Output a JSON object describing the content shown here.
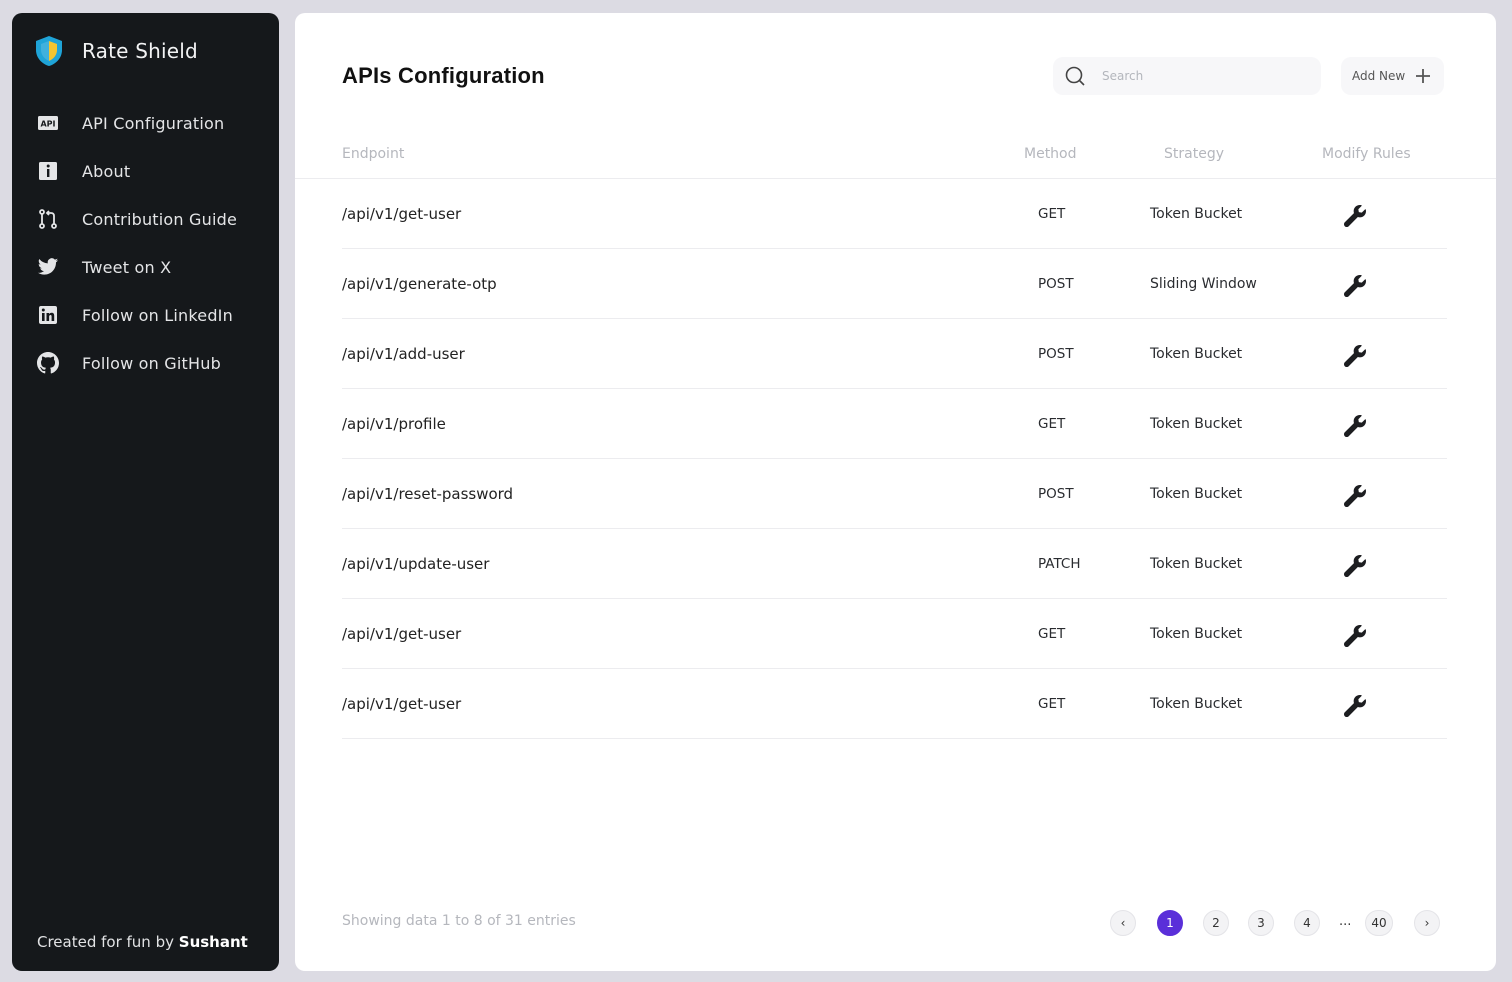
{
  "brand": {
    "name": "Rate Shield",
    "logo_icon": "shield-icon"
  },
  "nav": [
    {
      "icon": "api-icon",
      "label": "API Configuration"
    },
    {
      "icon": "info-icon",
      "label": "About"
    },
    {
      "icon": "git-pull-request-icon",
      "label": "Contribution Guide"
    },
    {
      "icon": "twitter-icon",
      "label": "Tweet on X"
    },
    {
      "icon": "linkedin-icon",
      "label": "Follow on LinkedIn"
    },
    {
      "icon": "github-icon",
      "label": "Follow on GitHub"
    }
  ],
  "footer": {
    "prefix": "Created for fun by ",
    "author": "Sushant"
  },
  "main": {
    "title": "APIs Configuration",
    "search_placeholder": "Search",
    "add_new_label": "Add New",
    "columns": {
      "endpoint": "Endpoint",
      "method": "Method",
      "strategy": "Strategy",
      "modify": "Modify Rules"
    },
    "rows": [
      {
        "endpoint": "/api/v1/get-user",
        "method": "GET",
        "strategy": "Token Bucket"
      },
      {
        "endpoint": "/api/v1/generate-otp",
        "method": "POST",
        "strategy": "Sliding Window"
      },
      {
        "endpoint": "/api/v1/add-user",
        "method": "POST",
        "strategy": "Token Bucket"
      },
      {
        "endpoint": "/api/v1/profile",
        "method": "GET",
        "strategy": "Token Bucket"
      },
      {
        "endpoint": "/api/v1/reset-password",
        "method": "POST",
        "strategy": "Token Bucket"
      },
      {
        "endpoint": "/api/v1/update-user",
        "method": "PATCH",
        "strategy": "Token Bucket"
      },
      {
        "endpoint": "/api/v1/get-user",
        "method": "GET",
        "strategy": "Token Bucket"
      },
      {
        "endpoint": "/api/v1/get-user",
        "method": "GET",
        "strategy": "Token Bucket"
      }
    ],
    "summary": "Showing data 1 to 8 of  31 entries",
    "pagination": {
      "prev": "‹",
      "pages": [
        "1",
        "2",
        "3",
        "4"
      ],
      "ellipsis": "...",
      "last": "40",
      "next": "›",
      "active_color": "#5a2fd9"
    }
  }
}
